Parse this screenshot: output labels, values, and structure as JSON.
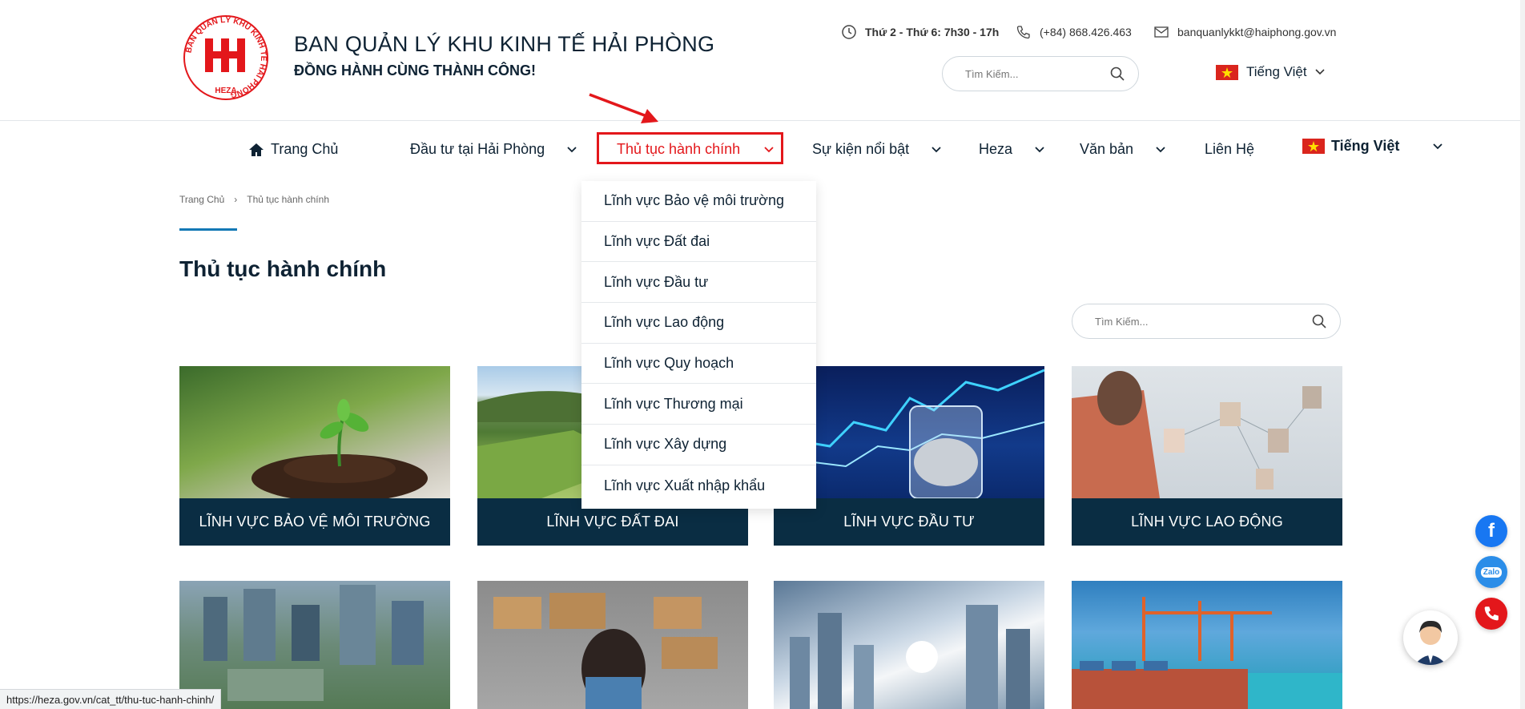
{
  "header": {
    "title": "BAN QUẢN LÝ KHU KINH TẾ HẢI PHÒNG",
    "slogan": "ĐỒNG HÀNH CÙNG THÀNH CÔNG!",
    "logo_text": "BAN QUẢN LÝ KHU KINH TẾ HẢI PHÒNG - HEZA",
    "hours": "Thứ 2 - Thứ 6: 7h30 - 17h",
    "phone": "(+84) 868.426.463",
    "email": "banquanlykkt@haiphong.gov.vn",
    "search_placeholder": "Tìm Kiếm...",
    "language": "Tiếng Việt"
  },
  "nav": {
    "items": [
      {
        "label": "Trang Chủ"
      },
      {
        "label": "Đầu tư tại Hải Phòng"
      },
      {
        "label": "Thủ tục hành chính"
      },
      {
        "label": "Sự kiện nổi bật"
      },
      {
        "label": "Heza"
      },
      {
        "label": "Văn bản"
      },
      {
        "label": "Liên Hệ"
      }
    ],
    "language": "Tiếng Việt"
  },
  "dropdown": {
    "items": [
      "Lĩnh vực Bảo vệ môi trường",
      "Lĩnh vực Đất đai",
      "Lĩnh vực Đầu tư",
      "Lĩnh vực Lao động",
      "Lĩnh vực Quy hoạch",
      "Lĩnh vực Thương mại",
      "Lĩnh vực Xây dựng",
      "Lĩnh vực Xuất nhập khẩu"
    ]
  },
  "breadcrumb": {
    "home": "Trang Chủ",
    "separator": "›",
    "current": "Thủ tục hành chính"
  },
  "main": {
    "title": "Thủ tục hành chính",
    "search_placeholder": "Tìm Kiếm...",
    "cards": [
      {
        "caption": "LĨNH VỰC BẢO VỆ MÔI TRƯỜNG"
      },
      {
        "caption": "LĨNH VỰC ĐẤT ĐAI"
      },
      {
        "caption": "LĨNH VỰC ĐẦU TƯ"
      },
      {
        "caption": "LĨNH VỰC LAO ĐỘNG"
      }
    ]
  },
  "floating": {
    "zalo_label": "Zalo",
    "facebook_label": "f"
  },
  "status_bar": {
    "url": "https://heza.gov.vn/cat_tt/thu-tuc-hanh-chinh/"
  },
  "colors": {
    "accent_red": "#e3171b",
    "navy": "#0a2d43",
    "link_blue": "#1378b5"
  }
}
